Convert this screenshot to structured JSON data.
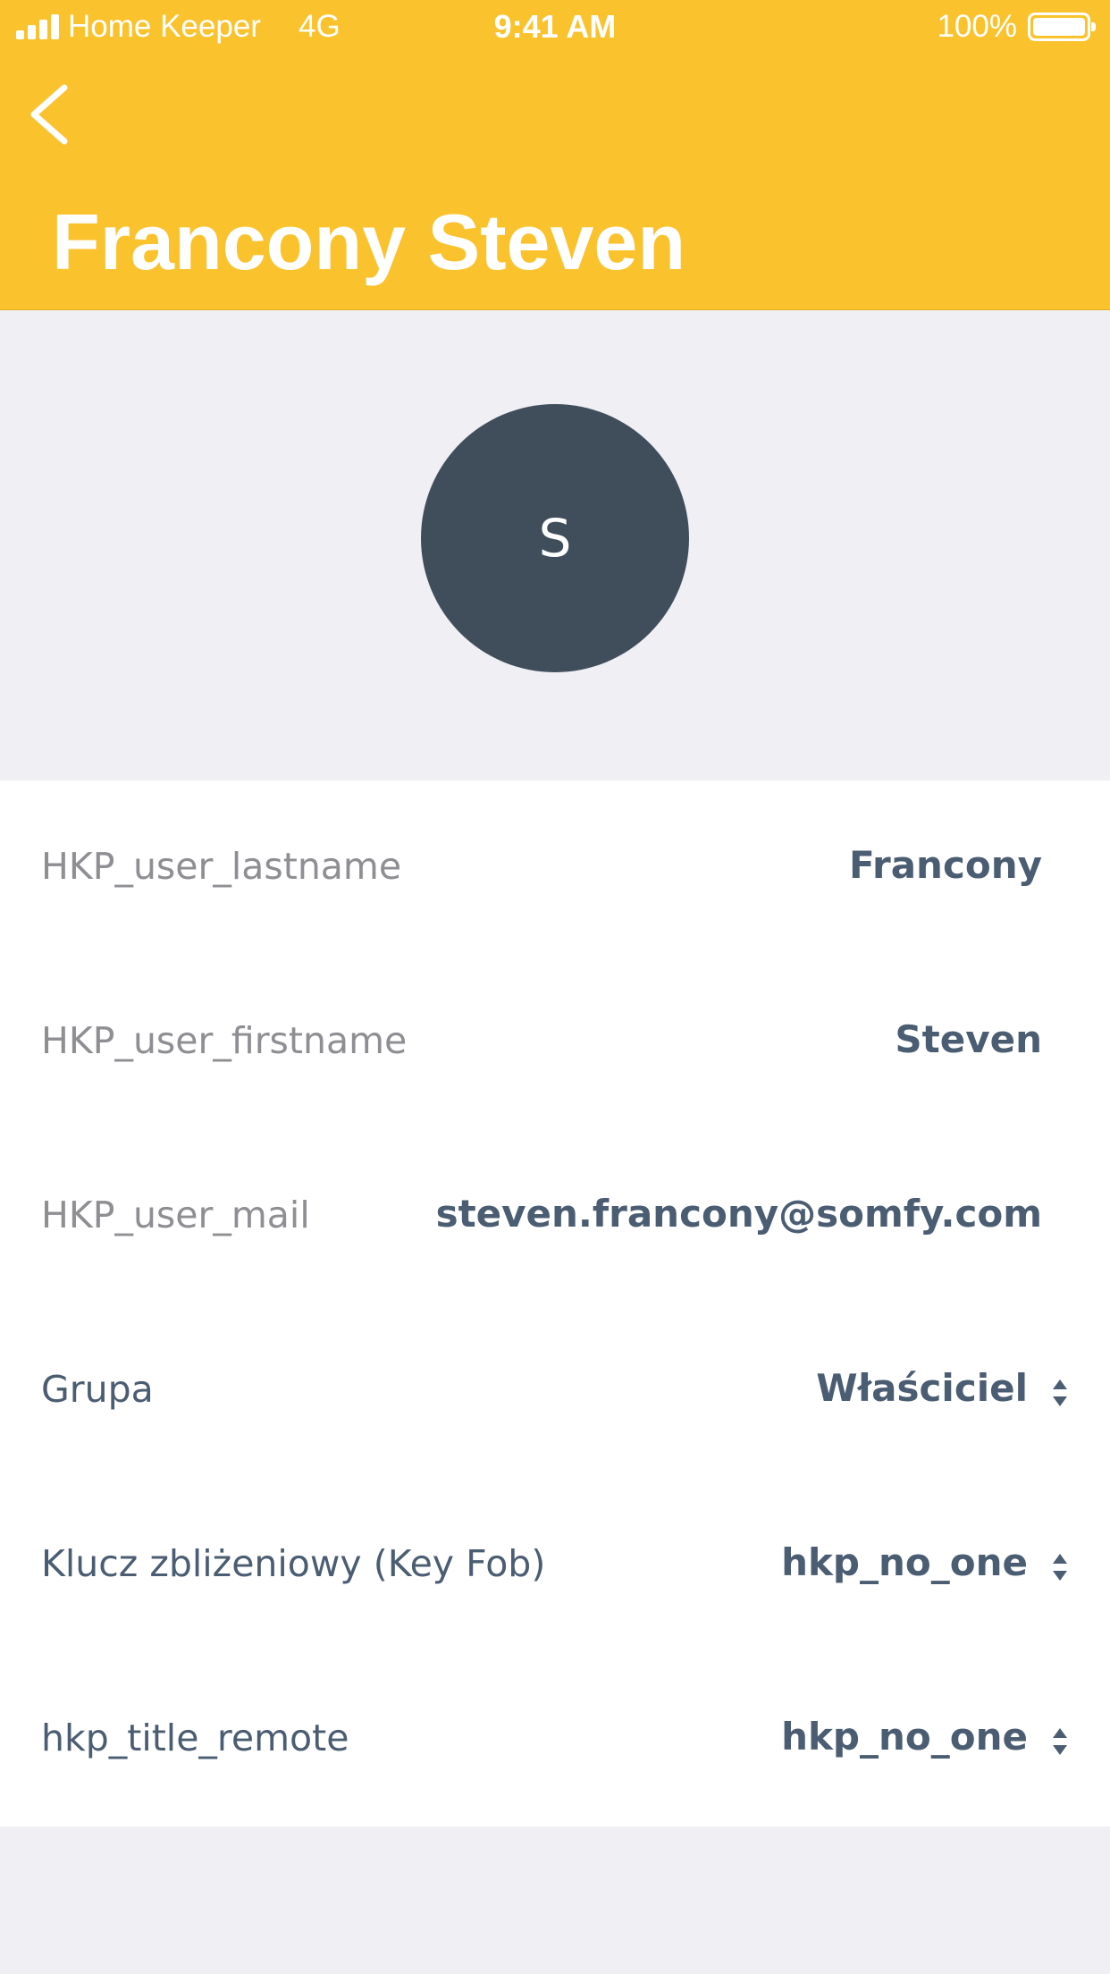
{
  "status_bar": {
    "carrier": "Home Keeper",
    "network": "4G",
    "time": "9:41 AM",
    "battery": "100%"
  },
  "header": {
    "title": "Francony Steven",
    "back_icon": "chevron-left-icon",
    "background_color": "#fac22d"
  },
  "avatar": {
    "initial": "S",
    "color": "#404e5b"
  },
  "fields": [
    {
      "label": "HKP_user_lastname",
      "value": "Francony",
      "type": "text"
    },
    {
      "label": "HKP_user_firstname",
      "value": "Steven",
      "type": "text"
    },
    {
      "label": "HKP_user_mail",
      "value": "steven.francony@somfy.com",
      "type": "text"
    },
    {
      "label": "Grupa",
      "value": "Właściciel",
      "type": "select",
      "icon": "sort-arrows-icon"
    },
    {
      "label": "Klucz zbliżeniowy (Key Fob)",
      "value": "hkp_no_one",
      "type": "select",
      "icon": "sort-arrows-icon"
    },
    {
      "label": "hkp_title_remote",
      "value": "hkp_no_one",
      "type": "select",
      "icon": "sort-arrows-icon"
    }
  ]
}
